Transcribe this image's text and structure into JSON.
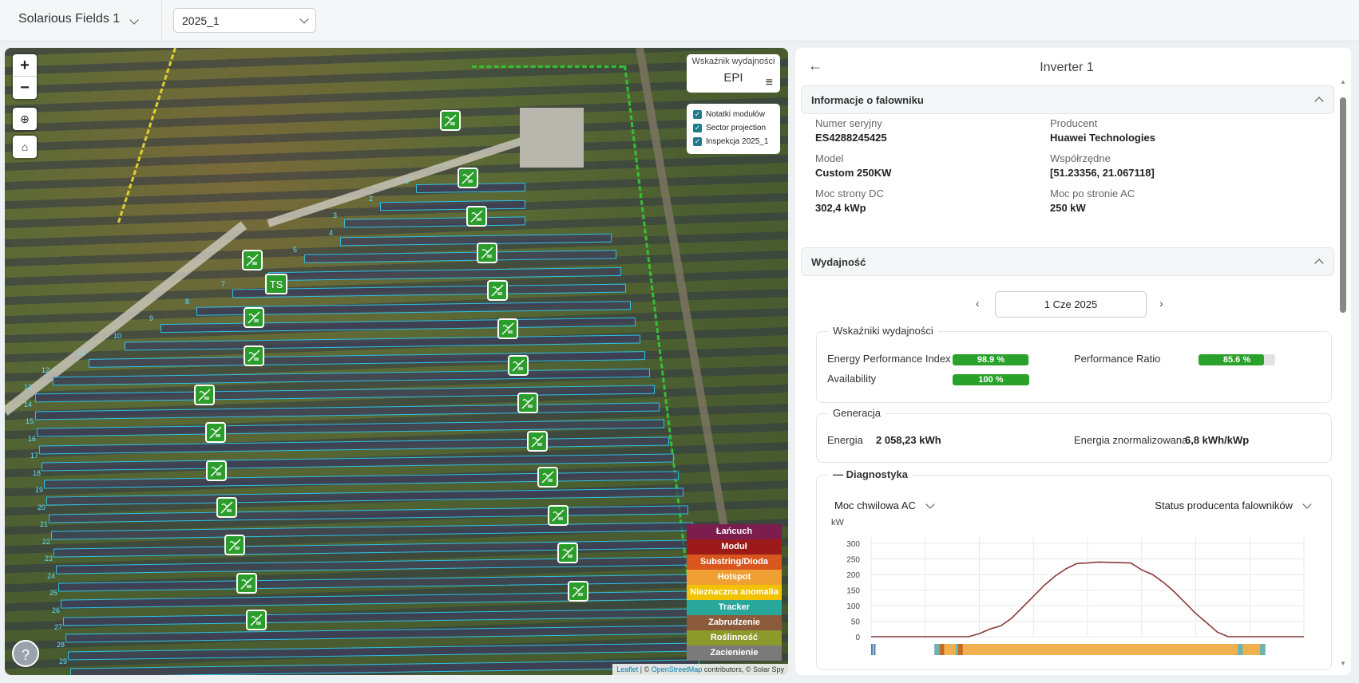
{
  "topbar": {
    "site": "Solarious Fields 1",
    "inspection": "2025_1"
  },
  "map": {
    "zoom_in": "+",
    "zoom_out": "−",
    "kpi_title": "Wskaźnik wydajności",
    "kpi_value": "EPI",
    "layers": [
      "Notatki modułów",
      "Sector projection",
      "Inspekcja 2025_1"
    ],
    "ts_label": "TS",
    "row_labels": [
      "1",
      "2",
      "3",
      "4",
      "5",
      "6",
      "7",
      "8",
      "9",
      "10",
      "11",
      "12",
      "13",
      "14",
      "15",
      "16",
      "17",
      "18",
      "19",
      "20",
      "21",
      "22",
      "23",
      "24",
      "25",
      "26",
      "27",
      "28",
      "29"
    ],
    "legend": [
      {
        "label": "Łańcuch",
        "color": "#7d1d4e"
      },
      {
        "label": "Moduł",
        "color": "#9c1a1a"
      },
      {
        "label": "Substring/Dioda",
        "color": "#d9561f"
      },
      {
        "label": "Hotspot",
        "color": "#f0a032"
      },
      {
        "label": "Nieznaczna anomalia",
        "color": "#f2c200"
      },
      {
        "label": "Tracker",
        "color": "#2aa79b"
      },
      {
        "label": "Zabrudzenie",
        "color": "#8b5a3a"
      },
      {
        "label": "Roślinność",
        "color": "#8c9a2b"
      },
      {
        "label": "Zacienienie",
        "color": "#7a7a7a"
      }
    ],
    "help": "?",
    "attribution": {
      "leaflet": "Leaflet",
      "sep": " | © ",
      "osm": "OpenStreetMap",
      "rest": " contributors, © Solar Spy"
    }
  },
  "panel": {
    "title": "Inverter 1",
    "info": {
      "header": "Informacje o falowniku",
      "fields": [
        {
          "label": "Numer seryjny",
          "value": "ES4288245425"
        },
        {
          "label": "Producent",
          "value": "Huawei Technologies"
        },
        {
          "label": "Model",
          "value": "Custom 250KW"
        },
        {
          "label": "Współrzędne",
          "value": "[51.23356, 21.067118]"
        },
        {
          "label": "Moc strony DC",
          "value": "302,4 kWp"
        },
        {
          "label": "Moc po stronie AC",
          "value": "250 kW"
        }
      ]
    },
    "perf": {
      "header": "Wydajność",
      "date": "1 Cze 2025",
      "kpi_caption": "Wskaźniki wydajności",
      "kpis": [
        {
          "label": "Energy Performance Index",
          "value": "98.9 %",
          "fill": 98.9
        },
        {
          "label": "Performance Ratio",
          "value": "85.6 %",
          "fill": 85.6
        },
        {
          "label": "Availability",
          "value": "100 %",
          "fill": 100
        }
      ],
      "gen_caption": "Generacja",
      "energy_label": "Energia",
      "energy_value": "2 058,23 kWh",
      "norm_label": "Energia znormalizowana",
      "norm_value": "6,8 kWh/kWp",
      "diag_caption": "Diagnostyka",
      "metric_select": "Moc chwilowa AC",
      "status_select": "Status producenta falowników"
    }
  },
  "chart_data": {
    "type": "line",
    "ylabel": "kW",
    "ylim": [
      0,
      300
    ],
    "yticks": [
      "0",
      "50",
      "100",
      "150",
      "200",
      "250",
      "300"
    ],
    "grid": true,
    "series": [
      {
        "color": "#8b3a3a",
        "values": [
          0,
          0,
          0,
          0,
          0,
          0,
          0,
          0,
          0,
          0,
          10,
          25,
          35,
          60,
          95,
          130,
          165,
          195,
          218,
          235,
          237,
          240,
          239,
          238,
          237,
          215,
          200,
          175,
          145,
          110,
          75,
          45,
          15,
          0,
          0,
          0,
          0,
          0,
          0,
          0,
          0
        ]
      }
    ],
    "status_bar": [
      {
        "from": 0,
        "to": 0.004,
        "color": "#4a7ab0"
      },
      {
        "from": 0.006,
        "to": 0.01,
        "color": "#4a7ab0"
      },
      {
        "from": 0.146,
        "to": 0.158,
        "color": "#6fb3b0"
      },
      {
        "from": 0.158,
        "to": 0.169,
        "color": "#c8691e"
      },
      {
        "from": 0.169,
        "to": 0.195,
        "color": "#f0b050"
      },
      {
        "from": 0.195,
        "to": 0.201,
        "color": "#6fb3b0"
      },
      {
        "from": 0.201,
        "to": 0.212,
        "color": "#c8691e"
      },
      {
        "from": 0.212,
        "to": 0.847,
        "color": "#f0b050"
      },
      {
        "from": 0.847,
        "to": 0.859,
        "color": "#6fb3b0"
      },
      {
        "from": 0.859,
        "to": 0.898,
        "color": "#f0b050"
      },
      {
        "from": 0.898,
        "to": 0.911,
        "color": "#6fb3b0"
      }
    ]
  }
}
